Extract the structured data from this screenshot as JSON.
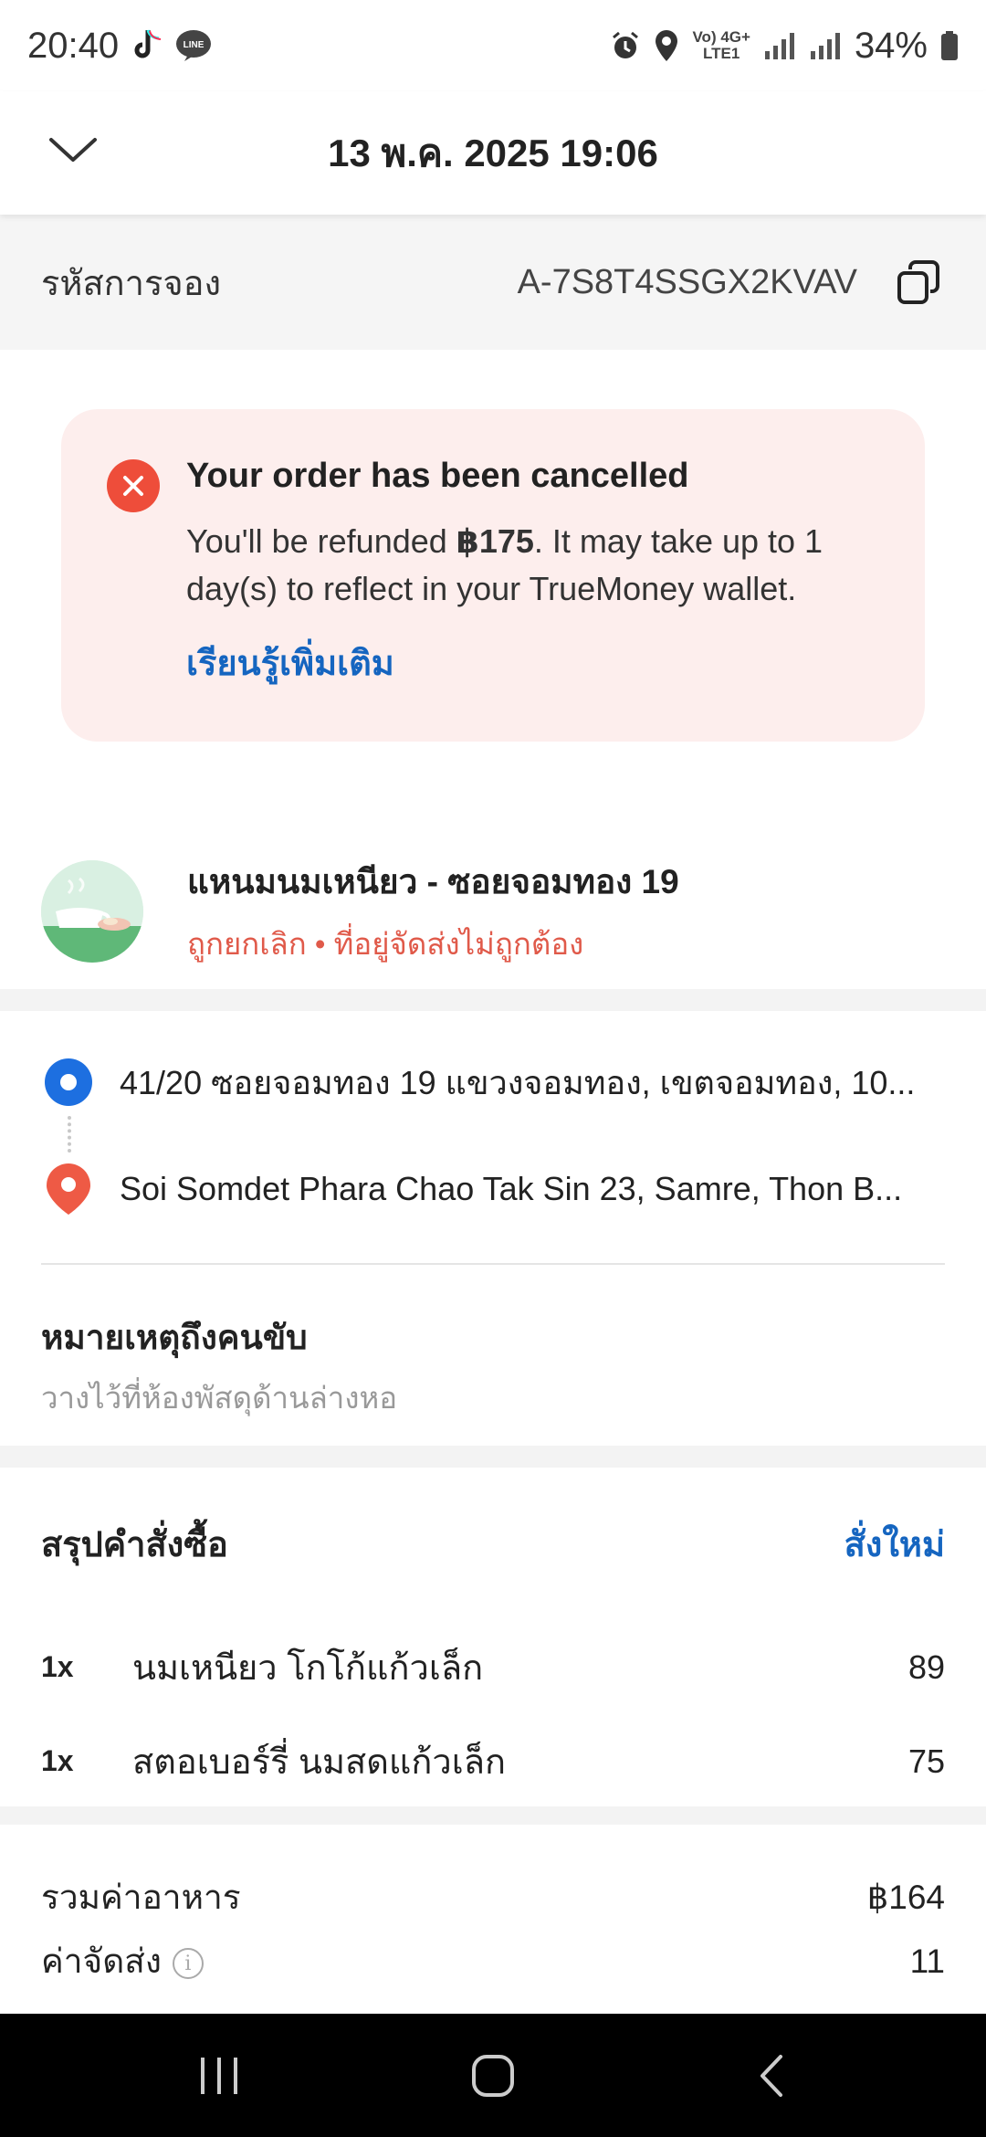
{
  "status_bar": {
    "time": "20:40",
    "net_top": "Vo) 4G+",
    "net_bottom": "LTE1",
    "battery": "34%"
  },
  "header": {
    "title": "13 พ.ค. 2025 19:06"
  },
  "booking": {
    "label": "รหัสการจอง",
    "code": "A-7S8T4SSGX2KVAV"
  },
  "cancel_notice": {
    "title": "Your order has been cancelled",
    "body_prefix": "You'll be refunded ",
    "amount": "฿175",
    "body_suffix": ". It may take up to 1 day(s) to reflect in your TrueMoney wallet.",
    "link": "เรียนรู้เพิ่มเติม"
  },
  "merchant": {
    "name": "แหนมนมเหนียว - ซอยจอมทอง 19",
    "status": "ถูกยกเลิก • ที่อยู่จัดส่งไม่ถูกต้อง"
  },
  "route": {
    "pickup": "41/20 ซอยจอมทอง 19 แขวงจอมทอง, เขตจอมทอง, 10...",
    "dropoff": "Soi Somdet Phara Chao Tak Sin 23, Samre, Thon B..."
  },
  "driver_note": {
    "title": "หมายเหตุถึงคนขับ",
    "text": "วางไว้ที่ห้องพัสดุด้านล่างหอ"
  },
  "summary": {
    "title": "สรุปคำสั่งซื้อ",
    "reorder": "สั่งใหม่",
    "items": [
      {
        "qty": "1x",
        "name": "นมเหนียว โกโก้แก้วเล็ก",
        "price": "89"
      },
      {
        "qty": "1x",
        "name": "สตอเบอร์รี่ นมสดแก้วเล็ก",
        "price": "75"
      }
    ],
    "food_total_label": "รวมค่าอาหาร",
    "food_total": "฿164",
    "delivery_label": "ค่าจัดส่ง",
    "delivery_fee": "11"
  },
  "colors": {
    "accent_blue": "#1565c0",
    "cancel_red": "#ee4d3a",
    "card_bg": "#fdeeed"
  }
}
